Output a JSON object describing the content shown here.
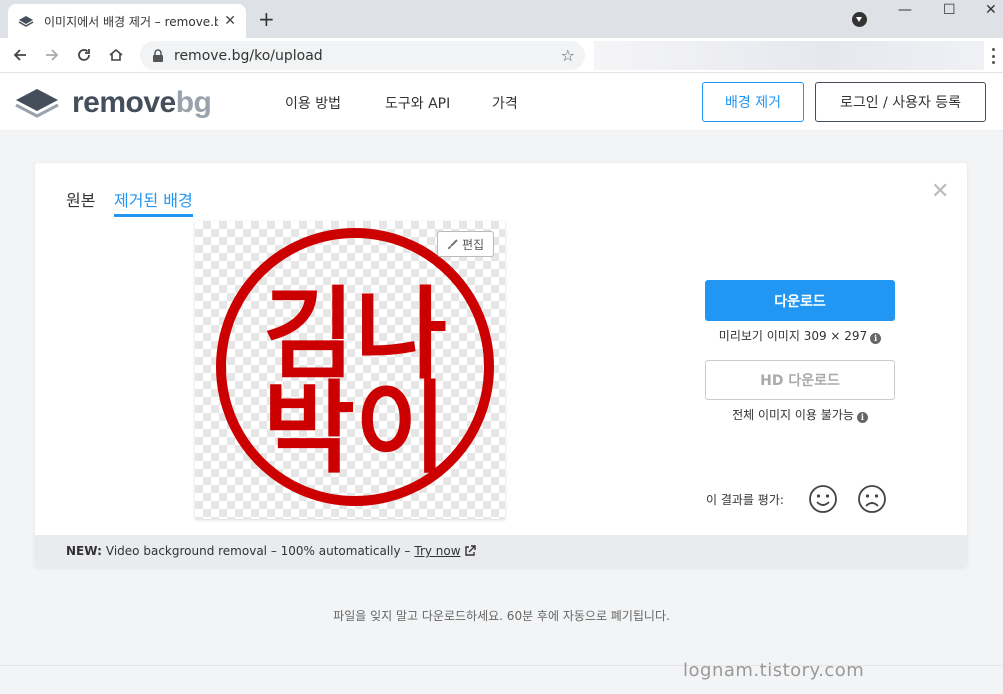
{
  "browser": {
    "tab_title": "이미지에서 배경 제거 – remove.bg",
    "tab_close": "✕",
    "new_tab": "+",
    "url": "remove.bg/ko/upload",
    "window_controls": {
      "minimize": "—",
      "maximize": "☐",
      "close": "✕"
    }
  },
  "header": {
    "logo_main": "remove",
    "logo_suffix": "bg",
    "nav": [
      "이용 방법",
      "도구와 API",
      "가격"
    ],
    "remove_bg_button": "배경 제거",
    "login_button": "로그인 / 사용자 등록"
  },
  "card": {
    "tabs": [
      "원본",
      "제거된 배경"
    ],
    "active_tab": "제거된 배경",
    "close": "✕",
    "edit_button": "편집",
    "download_button": "다운로드",
    "preview_note": "미리보기 이미지 309 × 297",
    "hd_download_button": "HD 다운로드",
    "hd_note": "전체 이미지 이용 불가능",
    "rate_label": "이 결과를 평가:",
    "stamp_text": [
      "김나",
      "박이"
    ],
    "footer": {
      "new_label": "NEW:",
      "text": "Video background removal – 100% automatically –",
      "link": "Try now"
    }
  },
  "bottom_note": "파일을 잊지 말고 다운로드하세요. 60분 후에 자동으로 폐기됩니다.",
  "watermark": "lognam.tistory.com",
  "colors": {
    "accent": "#2196f3",
    "stamp_red": "#cc0000",
    "logo_dark": "#454f5b"
  },
  "icons": [
    "layers-logo-icon",
    "lock-icon",
    "star-icon",
    "back-icon",
    "forward-icon",
    "reload-icon",
    "home-icon",
    "brush-icon",
    "info-icon",
    "smile-icon",
    "frown-icon",
    "external-link-icon"
  ]
}
